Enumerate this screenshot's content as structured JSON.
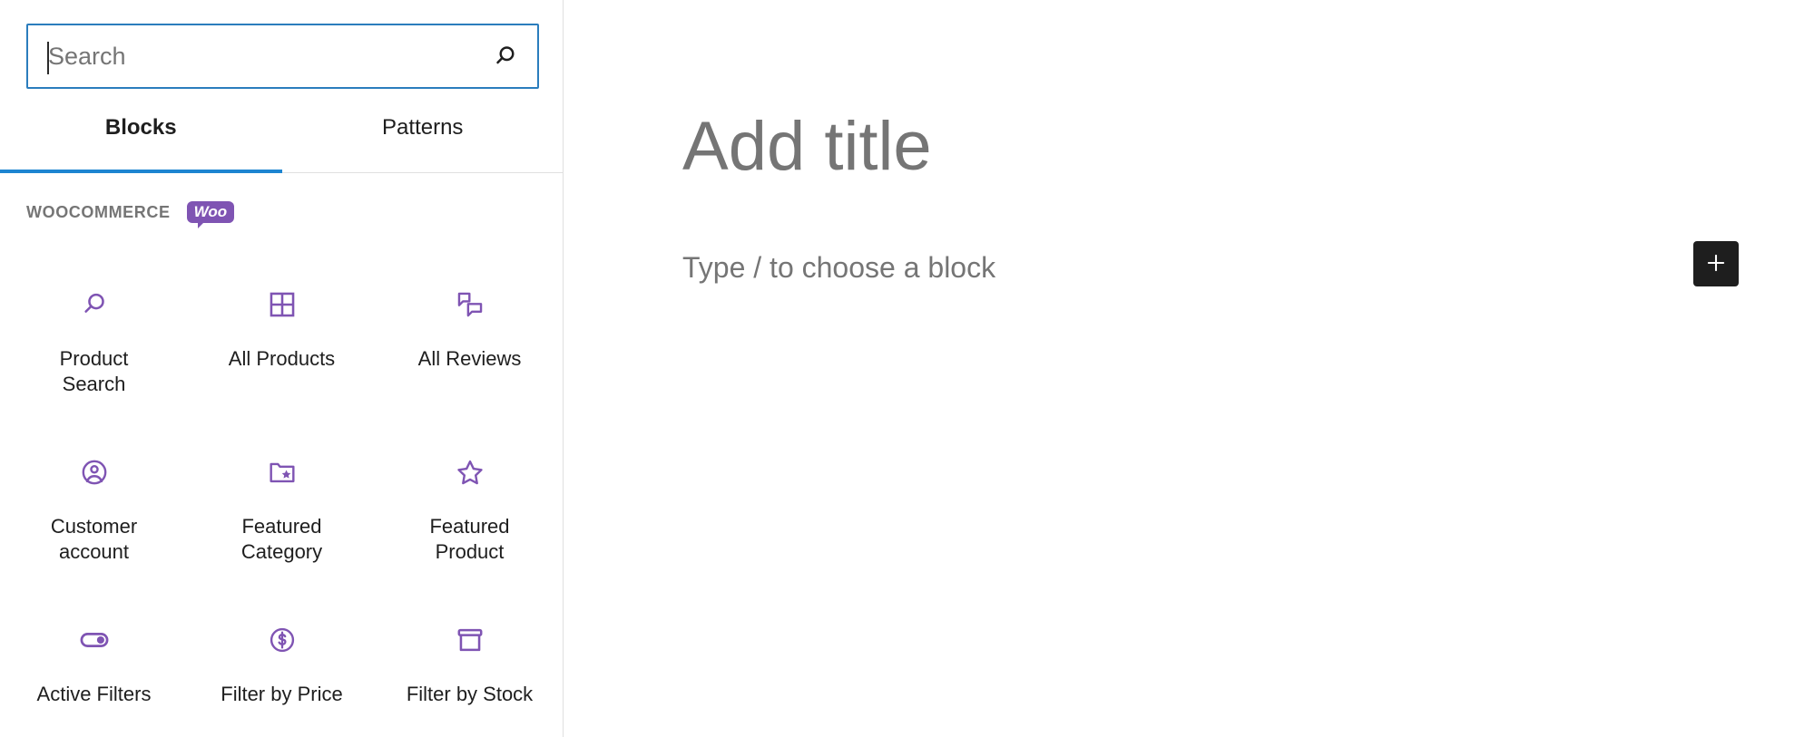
{
  "colors": {
    "accent_blue": "#1d85d1",
    "woo_purple": "#7f54b3",
    "text_primary": "#1e1e1e",
    "text_muted": "#757575",
    "border": "#e0e0e0",
    "toggle_bg": "#1e1e1e"
  },
  "inserter": {
    "search": {
      "value": "",
      "placeholder": "Search",
      "icon": "search-icon"
    },
    "tabs": [
      {
        "label": "Blocks",
        "active": true
      },
      {
        "label": "Patterns",
        "active": false
      }
    ],
    "category": {
      "title": "WOOCOMMERCE",
      "badge_label": "Woo"
    },
    "blocks": [
      {
        "label": "Product Search",
        "icon": "search-icon"
      },
      {
        "label": "All Products",
        "icon": "grid-icon"
      },
      {
        "label": "All Reviews",
        "icon": "comments-icon"
      },
      {
        "label": "Customer\naccount",
        "icon": "user-circle-icon"
      },
      {
        "label": "Featured\nCategory",
        "icon": "folder-star-icon"
      },
      {
        "label": "Featured\nProduct",
        "icon": "star-icon"
      },
      {
        "label": "Active Filters",
        "icon": "toggle-on-icon"
      },
      {
        "label": "Filter by Price",
        "icon": "dollar-circle-icon"
      },
      {
        "label": "Filter by Stock",
        "icon": "archive-box-icon"
      }
    ]
  },
  "editor": {
    "title_placeholder": "Add title",
    "block_placeholder": "Type / to choose a block",
    "add_block_button": {
      "label": "+",
      "icon": "plus-icon"
    }
  }
}
